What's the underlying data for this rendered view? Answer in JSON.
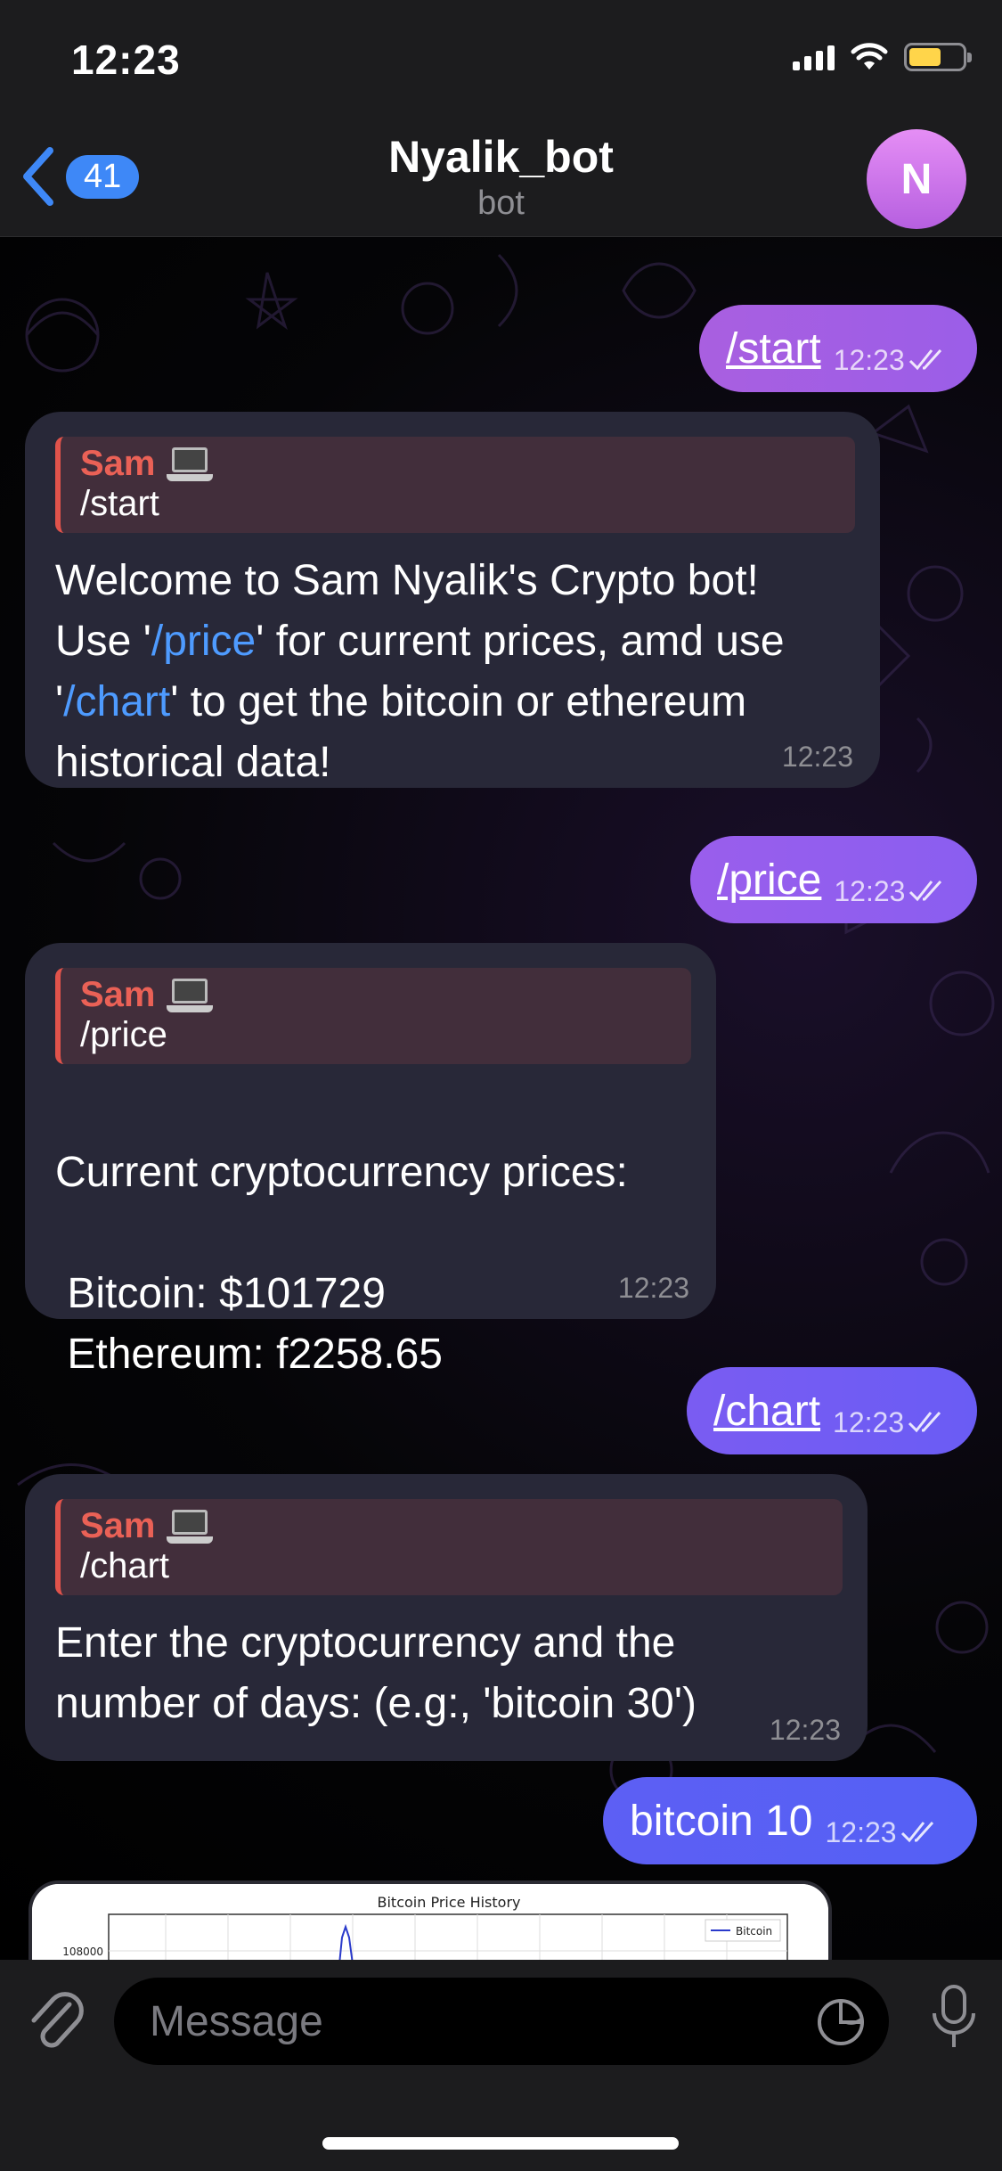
{
  "status_bar": {
    "time": "12:23"
  },
  "nav": {
    "back_count": "41",
    "title": "Nyalik_bot",
    "subtitle": "bot",
    "avatar_letter": "N"
  },
  "messages": [
    {
      "type": "outgoing",
      "text": "/start",
      "time": "12:23"
    },
    {
      "type": "incoming",
      "reply_name": "Sam",
      "reply_text": "/start",
      "segments": [
        "Welcome to Sam Nyalik's Crypto bot!",
        "Use '",
        "/price",
        "' for current prices, amd use",
        "'",
        "/chart",
        "' to get the bitcoin or ethereum",
        "historical data!"
      ],
      "time": "12:23"
    },
    {
      "type": "outgoing",
      "text": "/price",
      "time": "12:23"
    },
    {
      "type": "incoming",
      "reply_name": "Sam",
      "reply_text": "/price",
      "lines": [
        "Current cryptocurrency prices:",
        "",
        " Bitcoin: $101729",
        " Ethereum: f2258.65"
      ],
      "time": "12:23"
    },
    {
      "type": "outgoing",
      "text": "/chart",
      "time": "12:23"
    },
    {
      "type": "incoming",
      "reply_name": "Sam",
      "reply_text": "/chart",
      "lines": [
        "Enter the cryptocurrency and the",
        "number of days: (e.g:, 'bitcoin 30')"
      ],
      "time": "12:23"
    },
    {
      "type": "outgoing",
      "text": "bitcoin 10",
      "time": "12:23"
    }
  ],
  "chart_preview": {
    "title": "Bitcoin Price History",
    "y_tick": "108000",
    "legend": "Bitcoin"
  },
  "input": {
    "placeholder": "Message"
  },
  "colors": {
    "outgoing_gradient_start": "#a35ee6",
    "outgoing_gradient_end": "#5b5ff2",
    "incoming_bubble": "#282838",
    "accent_link": "#4e9bff",
    "reply_name": "#ea6156",
    "back_badge": "#3e88f7"
  },
  "icons": [
    "back-chevron-icon",
    "double-check-icon",
    "laptop-emoji-icon",
    "chevron-down-icon",
    "paperclip-icon",
    "sticker-icon",
    "microphone-icon",
    "wifi-icon",
    "battery-icon",
    "signal-icon"
  ]
}
